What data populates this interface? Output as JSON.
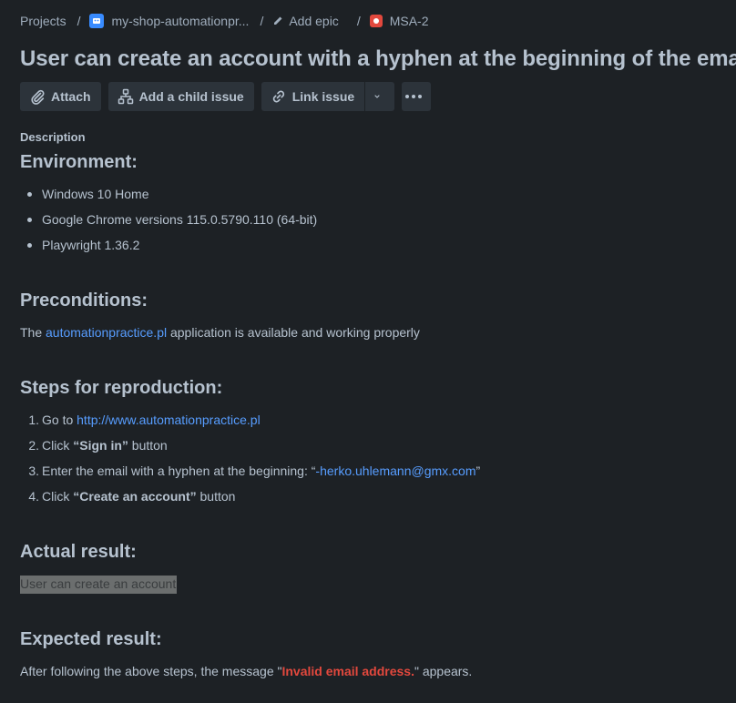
{
  "breadcrumb": {
    "projects": "Projects",
    "project": "my-shop-automationpr...",
    "epic": "Add epic",
    "issue_key": "MSA-2"
  },
  "title": "User can create an account with a hyphen at the beginning of the email",
  "toolbar": {
    "attach": "Attach",
    "add_child": "Add a child issue",
    "link_issue": "Link issue"
  },
  "description_label": "Description",
  "environment": {
    "heading": "Environment:",
    "items": [
      "Windows 10 Home",
      "Google Chrome versions 115.0.5790.110 (64-bit)",
      "Playwright 1.36.2"
    ]
  },
  "preconditions": {
    "heading": "Preconditions:",
    "text_before": "The ",
    "link": "automationpractice.pl",
    "text_after": " application is available and working properly"
  },
  "steps": {
    "heading": "Steps for reproduction:",
    "s1_num": "1.",
    "s1_text": "Go to ",
    "s1_link": "http://www.automationpractice.pl",
    "s2_num": "2.",
    "s2_pre": "Click ",
    "s2_bold": "“Sign in”",
    "s2_post": " button",
    "s3_num": "3.",
    "s3_pre": "Enter the email with a hyphen at the beginning: “",
    "s3_link": "-herko.uhlemann@gmx.com",
    "s3_post": "”",
    "s4_num": "4.",
    "s4_pre": "Click ",
    "s4_bold": "“Create an account”",
    "s4_post": " button"
  },
  "actual": {
    "heading": "Actual result:",
    "text": "User can create an account"
  },
  "expected": {
    "heading": "Expected result:",
    "text_before": "After following the above steps, the message \"",
    "highlight": "Invalid email address.",
    "text_after": "\" appears."
  },
  "colors": {
    "background": "#1d2125",
    "text": "#b6c2cf",
    "link": "#579dff",
    "error": "#e2483d",
    "button": "#2c333a"
  }
}
